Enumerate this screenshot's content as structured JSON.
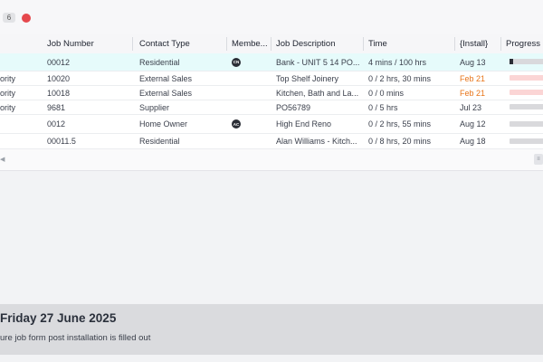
{
  "toolbar": {
    "count": "6"
  },
  "table": {
    "columns": [
      "Job Number",
      "Contact Type",
      "Membe...",
      "Job Description",
      "Time",
      "{Install}",
      "Progress"
    ],
    "rows": [
      {
        "lead": "",
        "job": "00012",
        "contact": "Residential",
        "member": "CN",
        "desc": "Bank - UNIT 5 14 PO...",
        "time": "4 mins / 100 hrs",
        "install": "Aug 13",
        "progress": 0.1,
        "progress_color": "grey"
      },
      {
        "lead": "ority",
        "job": "10020",
        "contact": "External Sales",
        "member": "",
        "desc": "Top Shelf Joinery",
        "time": "0 / 2 hrs, 30 mins",
        "install": "Feb 21",
        "progress": 0,
        "progress_color": "pink"
      },
      {
        "lead": "ority",
        "job": "10018",
        "contact": "External Sales",
        "member": "",
        "desc": "Kitchen, Bath and La...",
        "time": "0 / 0 mins",
        "install": "Feb 21",
        "progress": 0,
        "progress_color": "pink"
      },
      {
        "lead": "ority",
        "job": "9681",
        "contact": "Supplier",
        "member": "",
        "desc": "PO56789",
        "time": "0 / 5 hrs",
        "install": "Jul 23",
        "progress": 0,
        "progress_color": "grey"
      },
      {
        "lead": "",
        "job": "0012",
        "contact": "Home Owner",
        "member": "AC",
        "desc": "High End Reno",
        "time": "0 / 2 hrs, 55 mins",
        "install": "Aug 12",
        "progress": 0,
        "progress_color": "grey"
      },
      {
        "lead": "",
        "job": "00011.5",
        "contact": "Residential",
        "member": "",
        "desc": "Alan Williams - Kitch...",
        "time": "0 / 8 hrs, 20 mins",
        "install": "Aug 18",
        "progress": 0,
        "progress_color": "grey"
      }
    ]
  },
  "footer": {
    "date": "Friday 27 June 2025",
    "note": "ure job form post installation is filled out"
  }
}
